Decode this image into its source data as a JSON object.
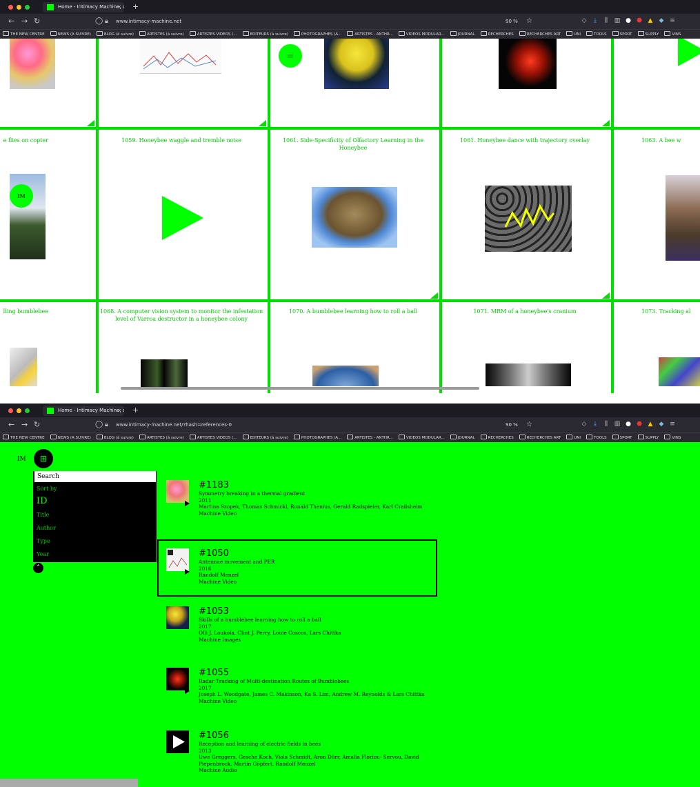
{
  "screen1": {
    "tab_title": "Home - Intimacy Machine, an o",
    "url": "www.intimacy-machine.net",
    "zoom": "90 %",
    "bookmarks": [
      "THE NEW CENTRE",
      "NEWS (A SUIVRE)",
      "BLOG (à suivre)",
      "ARTISTES (à suivre)",
      "ARTISTES VIDEOS (...",
      "EDITEURS (à suivre)",
      "PHOTOGRAPHES (A...",
      "ARTISTES - ANTHR...",
      "VIDEOS MODULAR...",
      "JOURNAL",
      "RECHERCHES",
      "RECHERCHES ART",
      "UNI",
      "TOOLS",
      "SPORT",
      "SUPPLY",
      "VINS"
    ],
    "menu_icon": "hamburger-icon",
    "im_label": "IM",
    "captions_row2": [
      "e flies on copter",
      "1059. Honeybee waggle and tremble noise",
      "1061. Side-Specificity of Olfactory Learning in the Honeybee",
      "1061. Honeybee dance with trajectory overlay",
      "1063. A bee w"
    ],
    "captions_row3": [
      "lling bumblebee",
      "1068. A computer vision system to monitor the infestation level of Varroa destructor in a honeybee colony",
      "1070. A bumblebee learning how to roll a ball",
      "1071. MRM of a honeybee's cranium",
      "1073. Tracking al"
    ]
  },
  "screen2": {
    "tab_title": "Home - Intimacy Machine, an o",
    "url": "www.intimacy-machine.net/?hash=references-0",
    "zoom": "90 %",
    "im_label": "IM",
    "menu": {
      "search": "Search",
      "sort_by": "Sort by",
      "items": [
        "ID",
        "Title",
        "Author",
        "Type",
        "Year"
      ],
      "active": "ID"
    },
    "entries": [
      {
        "id": "#1183",
        "title": "Symmetry breaking in a thermal gradient",
        "year": "2011",
        "authors": "Martina Szopek, Thomas Schmickl, Ronald Thenius, Gerald Radspieler, Karl Crailsheim",
        "type": "Machine Video"
      },
      {
        "id": "#1050",
        "title": "Antennae movement and PER",
        "year": "2016",
        "authors": "Randolf Menzel",
        "type": "Machine Video"
      },
      {
        "id": "#1053",
        "title": "Skills of a bumblebee learning how to roll a ball",
        "year": "2017",
        "authors": "Olli J. Loukola, Clint J. Perry, Louie Coscos, Lars Chittka",
        "type": "Machine Images"
      },
      {
        "id": "#1055",
        "title": "Radar Tracking of Multi-destination Routes of Bumblebees",
        "year": "2017",
        "authors": "Joseph L. Woodgate, James C. Makinson, Ka S. Lim, Andrew M. Reynolds & Lars Chittka",
        "type": "Machine Video"
      },
      {
        "id": "#1056",
        "title": "Reception and learning of electric fields in bees",
        "year": "2013",
        "authors": "Uwe Greggers, Gesche Koch, Viola Schmidt, Aron Dürr, Amalia Floriou- Servou, David Piepenbrock, Martin Göpfert, Randolf Menzel",
        "type": "Machine Audio"
      }
    ],
    "selected_entry": "#1050"
  },
  "colors": {
    "accent": "#00ff00",
    "grid_line": "#00e000",
    "caption": "#00cc00",
    "chrome": "#2b2a33",
    "tabbar": "#1c1b22"
  }
}
